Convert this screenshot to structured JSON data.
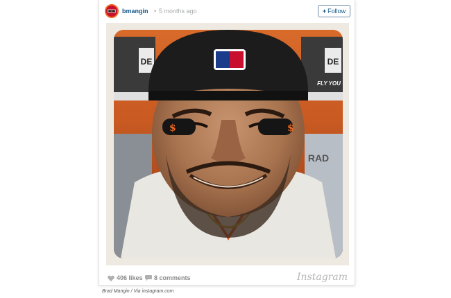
{
  "post": {
    "username": "bmangin",
    "separator": "•",
    "time_ago": "5 months ago",
    "follow_label": "Follow",
    "follow_plus": "+",
    "photo_cap_text": "FLY YOU",
    "photo_shirt_text": "RAD",
    "photo_logo_text": "DE",
    "likes": "406 likes",
    "comments": "8 comments",
    "brand": "Instagram",
    "icons": {
      "avatar": "sf-giants-logo",
      "likes": "heart-icon",
      "comments": "comment-bubble-icon",
      "follow": "plus-icon"
    },
    "colors": {
      "username": "#125688",
      "follow_border": "#6e89a5",
      "meta": "#a5a7aa"
    }
  },
  "caption": "Brad Mangin / Via instagram.com"
}
